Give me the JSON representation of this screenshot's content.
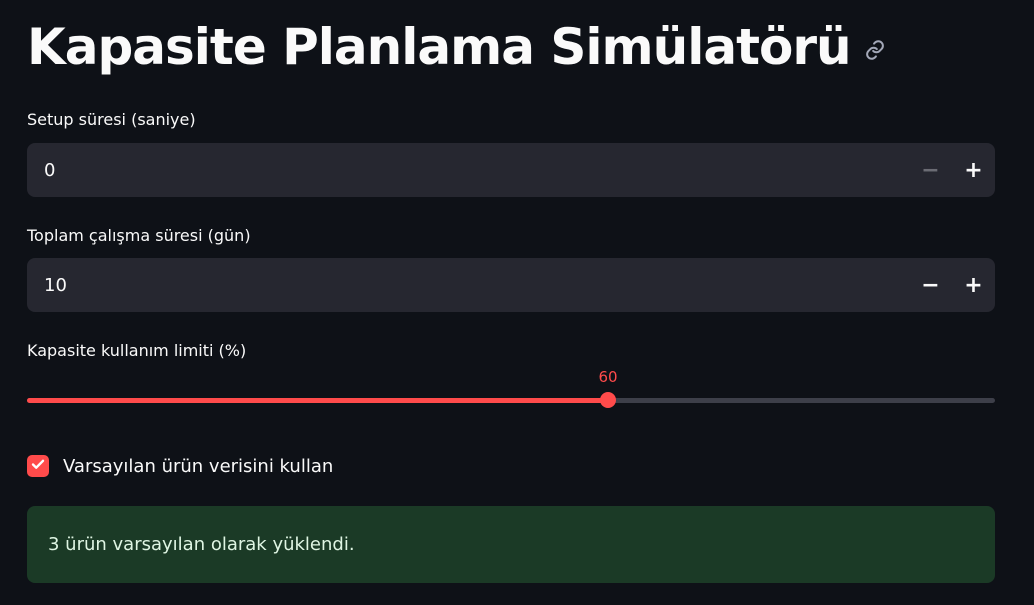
{
  "title": "Kapasite Planlama Simülatörü",
  "icons": {
    "title_link": "link-icon",
    "checkbox": "check-icon"
  },
  "colors": {
    "background": "#0e1117",
    "input_background": "#262730",
    "accent": "#ff4b4b",
    "success_background": "#1b3a26"
  },
  "setup_time": {
    "label": "Setup süresi (saniye)",
    "value": "0",
    "minus_label": "−",
    "plus_label": "+",
    "minus_disabled": true
  },
  "total_work_time": {
    "label": "Toplam çalışma süresi (gün)",
    "value": "10",
    "minus_label": "−",
    "plus_label": "+"
  },
  "capacity_limit": {
    "label": "Kapasite kullanım limiti (%)",
    "value": 60,
    "min": 0,
    "max": 100,
    "value_text": "60"
  },
  "default_data_checkbox": {
    "label": "Varsayılan ürün verisini kullan",
    "checked": true
  },
  "success_message": "3 ürün varsayılan olarak yüklendi."
}
